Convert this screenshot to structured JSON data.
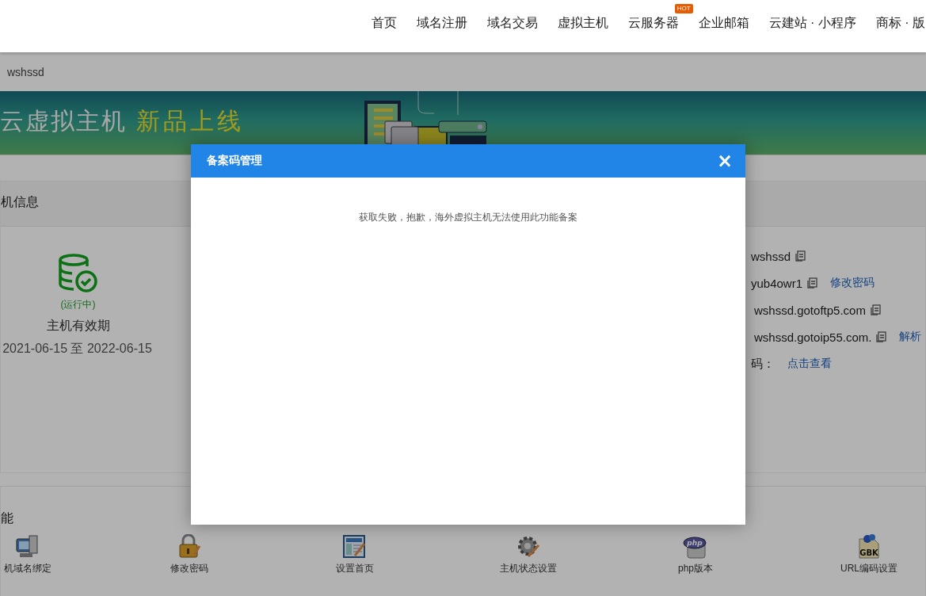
{
  "nav": [
    {
      "label": "首页"
    },
    {
      "label": "域名注册"
    },
    {
      "label": "域名交易"
    },
    {
      "label": "虚拟主机"
    },
    {
      "label": "云服务器",
      "badge": "HOT"
    },
    {
      "label": "企业邮箱"
    },
    {
      "label": "云建站 · 小程序"
    },
    {
      "label": "商标 · 版"
    }
  ],
  "breadcrumb": "wshssd",
  "banner": {
    "title": "云虚拟主机",
    "tagline": "新品上线"
  },
  "info_panel": {
    "title": "机信息",
    "status": "(运行中)",
    "validity_label": "主机有效期",
    "validity": "2021-06-15 至 2022-06-15",
    "rows": [
      {
        "value": "wshssd"
      },
      {
        "value": "yub4owr1",
        "link": "修改密码"
      },
      {
        "value": "wshssd.gotoftp5.com"
      },
      {
        "value": "wshssd.gotoip55.com.",
        "link": "解析"
      },
      {
        "label": "码：",
        "link": "点击查看"
      }
    ]
  },
  "functions": {
    "title": "能",
    "items": [
      {
        "kind": "computer",
        "label": "机域名绑定"
      },
      {
        "kind": "lock",
        "label": "修改密码"
      },
      {
        "kind": "page",
        "label": "设置首页"
      },
      {
        "kind": "gear",
        "label": "主机状态设置"
      },
      {
        "kind": "php",
        "icon_text": "php",
        "label": "php版本"
      },
      {
        "kind": "gbk",
        "icon_text": "GBK",
        "label": "URL编码设置"
      }
    ]
  },
  "modal": {
    "title": "备案码管理",
    "close": "×",
    "message": "获取失败，抱歉，海外虚拟主机无法使用此功能备案"
  }
}
